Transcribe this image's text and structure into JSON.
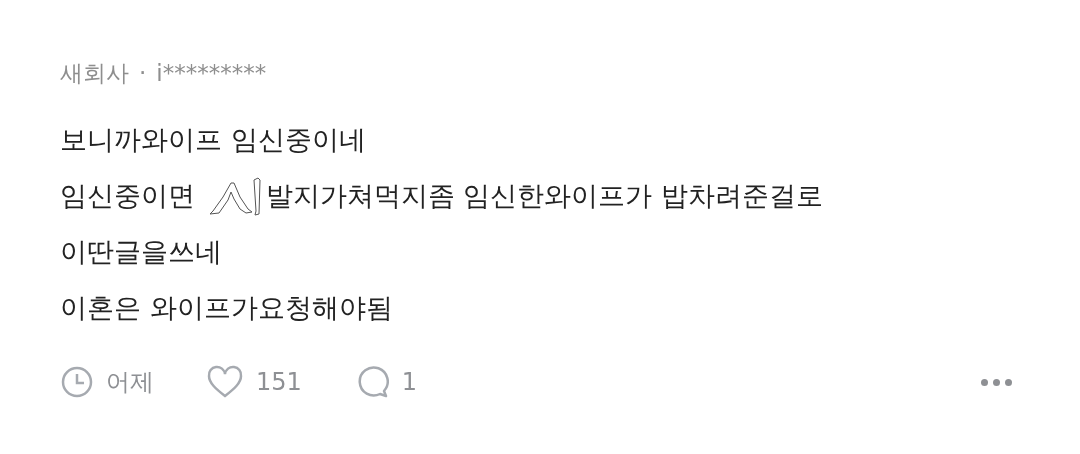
{
  "author": {
    "company": "새회사",
    "separator": "·",
    "user": "i*********"
  },
  "lines": [
    [
      {
        "kind": "text",
        "text": "보니까와이프 임신중이네"
      }
    ],
    [
      {
        "kind": "text",
        "text": "임신중이면 "
      },
      {
        "kind": "drawing"
      },
      {
        "kind": "text",
        "text": "발지가쳐먹지좀 임신한와이프가 밥차려준걸로"
      }
    ],
    [
      {
        "kind": "text",
        "text": "이딴글을쓰네"
      }
    ],
    [
      {
        "kind": "text",
        "text": "이혼은 와이프가요청해야됨"
      }
    ]
  ],
  "footer": {
    "time": "어제",
    "likes": "151",
    "comments": "1"
  }
}
